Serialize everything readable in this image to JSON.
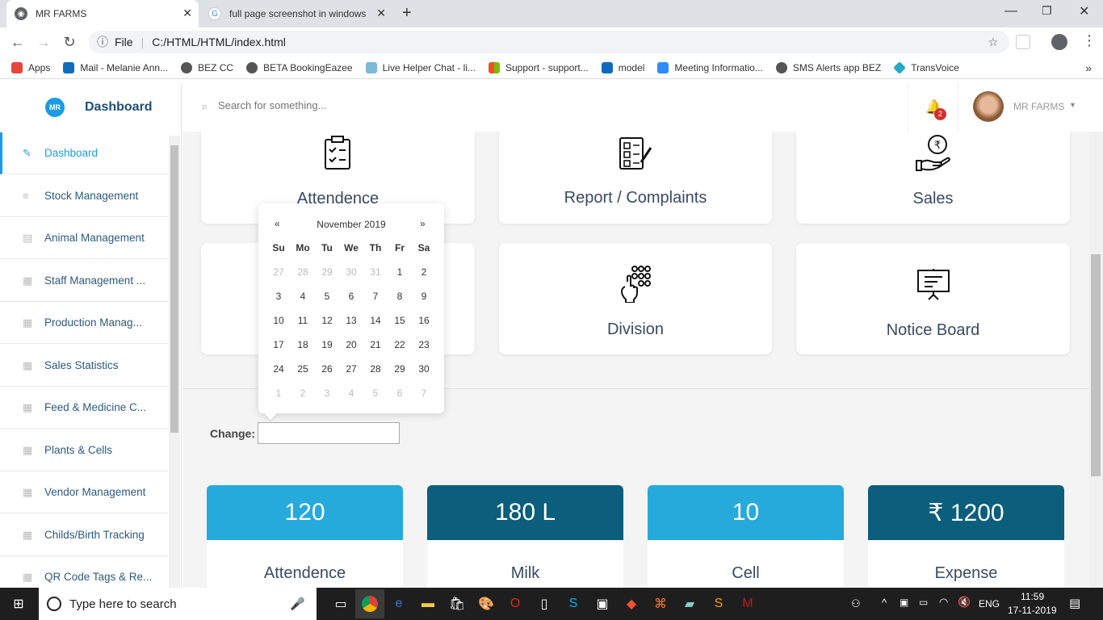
{
  "browser": {
    "tabs": [
      {
        "title": "MR FARMS"
      },
      {
        "title": "full page screenshot in windows"
      }
    ],
    "url_scheme": "File",
    "url": "C:/HTML/HTML/index.html",
    "bookmarks": [
      "Apps",
      "Mail - Melanie Ann...",
      "BEZ CC",
      "BETA BookingEazee",
      "Live Helper Chat - li...",
      "Support - support...",
      "model",
      "Meeting Informatio...",
      "SMS Alerts app BEZ",
      "TransVoice"
    ]
  },
  "sidebar": {
    "brand_logo_text": "MR",
    "brand": "Dashboard",
    "items": [
      {
        "label": "Dashboard",
        "icon": "pencil-icon"
      },
      {
        "label": "Stock Management",
        "icon": "list-icon"
      },
      {
        "label": "Animal Management",
        "icon": "document-icon"
      },
      {
        "label": "Staff Management ...",
        "icon": "grid-icon"
      },
      {
        "label": "Production Manag...",
        "icon": "table-icon"
      },
      {
        "label": "Sales Statistics",
        "icon": "table-icon"
      },
      {
        "label": "Feed & Medicine C...",
        "icon": "table-icon"
      },
      {
        "label": "Plants & Cells",
        "icon": "table-icon"
      },
      {
        "label": "Vendor Management",
        "icon": "table-icon"
      },
      {
        "label": "Childs/Birth Tracking",
        "icon": "table-icon"
      },
      {
        "label": "QR Code Tags & Re...",
        "icon": "table-icon"
      }
    ]
  },
  "header": {
    "search_placeholder": "Search for something...",
    "notification_count": "2",
    "user": "MR FARMS"
  },
  "cards": [
    {
      "label": "Attendence",
      "icon": "clipboard-icon"
    },
    {
      "label": "Report / Complaints",
      "icon": "checklist-icon"
    },
    {
      "label": "Sales",
      "icon": "rupee-hand-icon"
    },
    {
      "label": "Division",
      "icon": "hand-grid-icon"
    },
    {
      "label": "Notice Board",
      "icon": "presentation-board-icon"
    }
  ],
  "datepicker": {
    "prev": "«",
    "next": "»",
    "month": "November 2019",
    "weekdays": [
      "Su",
      "Mo",
      "Tu",
      "We",
      "Th",
      "Fr",
      "Sa"
    ],
    "days": [
      "27",
      "28",
      "29",
      "30",
      "31",
      "1",
      "2",
      "3",
      "4",
      "5",
      "6",
      "7",
      "8",
      "9",
      "10",
      "11",
      "12",
      "13",
      "14",
      "15",
      "16",
      "17",
      "18",
      "19",
      "20",
      "21",
      "22",
      "23",
      "24",
      "25",
      "26",
      "27",
      "28",
      "29",
      "30",
      "1",
      "2",
      "3",
      "4",
      "5",
      "6",
      "7"
    ]
  },
  "change_label": "Change:",
  "change_value": "",
  "stats": [
    {
      "value": "120",
      "label": "Attendence",
      "color": "#26aadc"
    },
    {
      "value": "180 L",
      "label": "Milk",
      "color": "#0b5e7c"
    },
    {
      "value": "10",
      "label": "Cell",
      "color": "#26aadc"
    },
    {
      "value": "₹ 1200",
      "label": "Expense",
      "color": "#0b5e7c"
    }
  ],
  "taskbar": {
    "search": "Type here to search",
    "lang": "ENG",
    "time": "11:59",
    "date": "17-11-2019"
  }
}
